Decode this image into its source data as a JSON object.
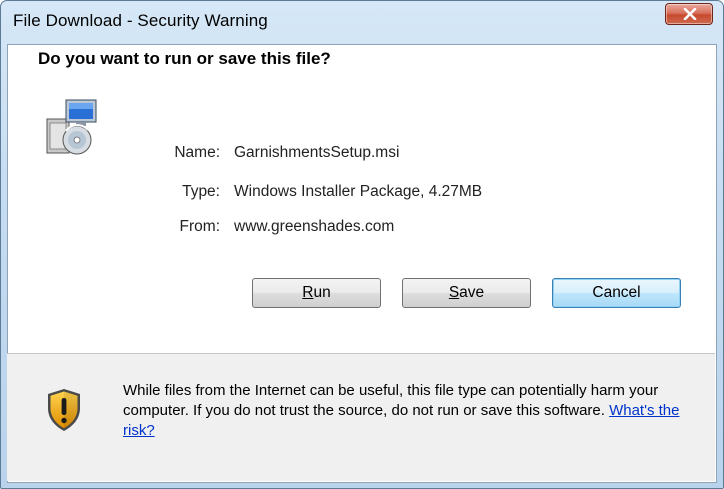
{
  "window": {
    "title": "File Download - Security Warning"
  },
  "dialog": {
    "question": "Do you want to run or save this file?",
    "info": [
      {
        "label": "Name:",
        "value": "GarnishmentsSetup.msi"
      },
      {
        "label": "Type:",
        "value": "Windows Installer Package, 4.27MB"
      },
      {
        "label": "From:",
        "value": "www.greenshades.com"
      }
    ],
    "buttons": {
      "run": {
        "mnemonic": "R",
        "rest": "un"
      },
      "save": {
        "mnemonic": "S",
        "rest": "ave"
      },
      "cancel": {
        "label": "Cancel"
      }
    },
    "warning": {
      "text": "While files from the Internet can be useful, this file type can potentially harm your computer. If you do not trust the source, do not run or save this software.",
      "link": "What's the risk?"
    }
  },
  "icons": {
    "close": "close-icon",
    "installer": "installer-package-icon",
    "shield": "security-shield-icon"
  },
  "colors": {
    "link": "#0033cc",
    "default_button_border": "#3c7fb1",
    "close_button": "#c74a2f"
  }
}
